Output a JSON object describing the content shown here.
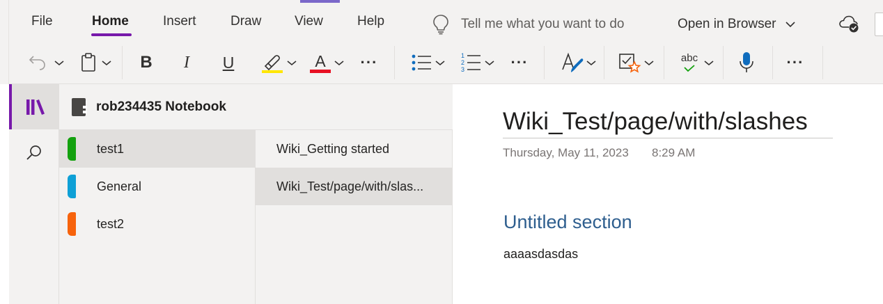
{
  "ribbon": {
    "tabs": [
      {
        "label": "File"
      },
      {
        "label": "Home"
      },
      {
        "label": "Insert"
      },
      {
        "label": "Draw"
      },
      {
        "label": "View"
      },
      {
        "label": "Help"
      }
    ],
    "active_tab": "Home",
    "tell_me_placeholder": "Tell me what you want to do",
    "open_in_browser": "Open in Browser",
    "toolbar": {
      "bold_glyph": "B",
      "italic_glyph": "I",
      "underline_glyph": "U",
      "font_color_glyph": "A",
      "highlight_color": "#ffe600",
      "font_color": "#e81123",
      "spell_glyph": "abc",
      "more_glyph": "···"
    },
    "icons": [
      "undo-icon",
      "clipboard-icon",
      "bold-icon",
      "italic-icon",
      "underline-icon",
      "highlighter-icon",
      "font-color-icon",
      "more-icon",
      "bullets-icon",
      "numbering-icon",
      "styles-icon",
      "tag-icon",
      "spelling-icon",
      "dictate-icon",
      "cloud-sync-icon",
      "lightbulb-icon"
    ]
  },
  "navigation": {
    "notebook_name": "rob234435 Notebook",
    "sections": [
      {
        "label": "test1",
        "color": "#13a10e",
        "selected": true
      },
      {
        "label": "General",
        "color": "#0ea0d6",
        "selected": false
      },
      {
        "label": "test2",
        "color": "#f7630c",
        "selected": false
      }
    ],
    "pages": [
      {
        "label": "Wiki_Getting started",
        "selected": false
      },
      {
        "label": "Wiki_Test/page/with/slas...",
        "selected": true
      }
    ]
  },
  "page": {
    "title": "Wiki_Test/page/with/slashes",
    "date": "Thursday, May 11, 2023",
    "time": "8:29 AM",
    "heading": "Untitled section",
    "body": "aaaasdasdas"
  },
  "colors": {
    "accent": "#7719aa",
    "heading": "#2e5e8e"
  }
}
